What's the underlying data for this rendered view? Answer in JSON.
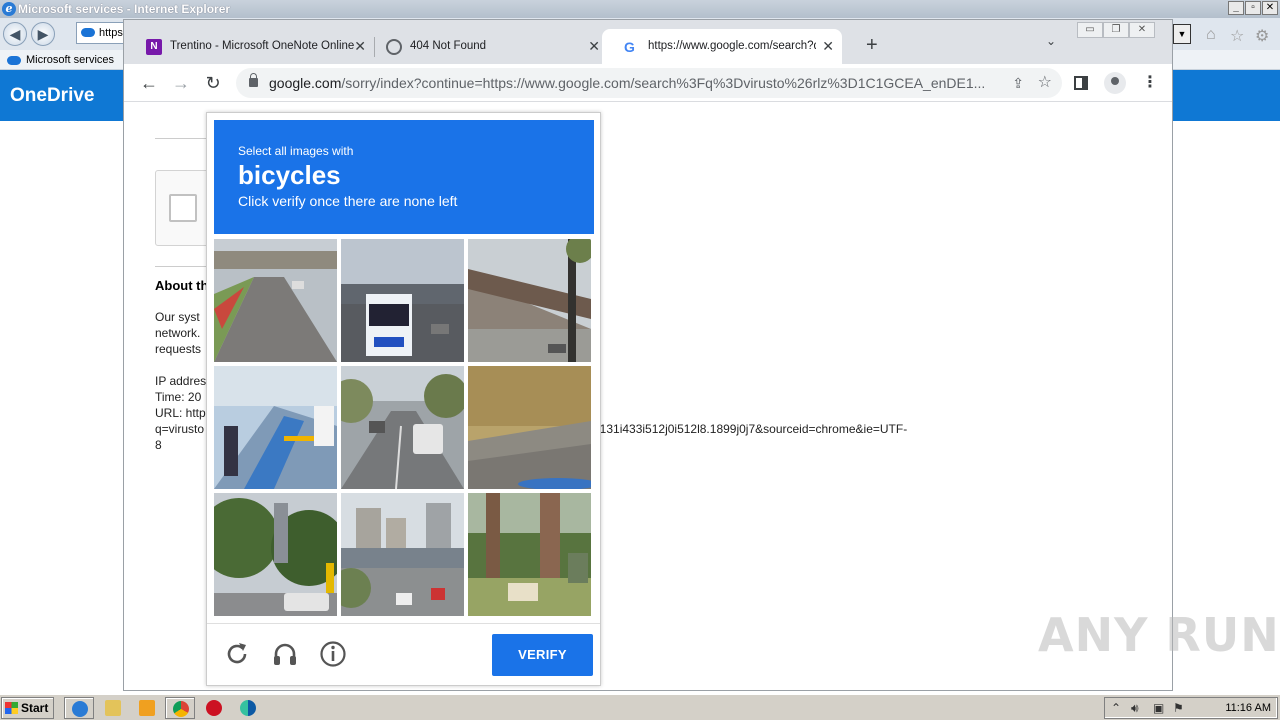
{
  "ie": {
    "title": "Microsoft services - Internet Explorer",
    "address": "https",
    "tab": "Microsoft services",
    "onedrive": "OneDrive"
  },
  "chrome": {
    "tabs": [
      {
        "label": "Trentino - Microsoft OneNote Online",
        "icon": "onenote-icon"
      },
      {
        "label": "404 Not Found",
        "icon": "globe-icon"
      },
      {
        "label": "https://www.google.com/search?q=",
        "icon": "google-icon",
        "active": true
      }
    ],
    "url_main": "google.com",
    "url_rest": "/sorry/index?continue=https://www.google.com/search%3Fq%3Dvirusto%26rlz%3D1C1GCEA_enDE1..."
  },
  "page": {
    "about_heading": "About th",
    "para1": [
      "Our syst",
      "network.",
      "requests"
    ],
    "info": [
      "IP addres",
      "Time: 20",
      "URL: http",
      "q=virusto",
      "8"
    ],
    "url_tail": "i131i433i512j0i512l8.1899j0j7&sourceid=chrome&ie=UTF-"
  },
  "captcha": {
    "pre": "Select all images with",
    "object": "bicycles",
    "post": "Click verify once there are none left",
    "verify": "VERIFY",
    "tiles": [
      "tile-road-overpass",
      "tile-city-bus",
      "tile-station-platform",
      "tile-bike-share-dock",
      "tile-street-traffic",
      "tile-grass-field",
      "tile-trees-street",
      "tile-highway-city",
      "tile-tree-trunks"
    ]
  },
  "watermark": "ANY RUN",
  "taskbar": {
    "start": "Start",
    "clock": "11:16 AM"
  },
  "colors": {
    "captcha_blue": "#1a73e8",
    "onedrive_blue": "#0f78d4"
  }
}
